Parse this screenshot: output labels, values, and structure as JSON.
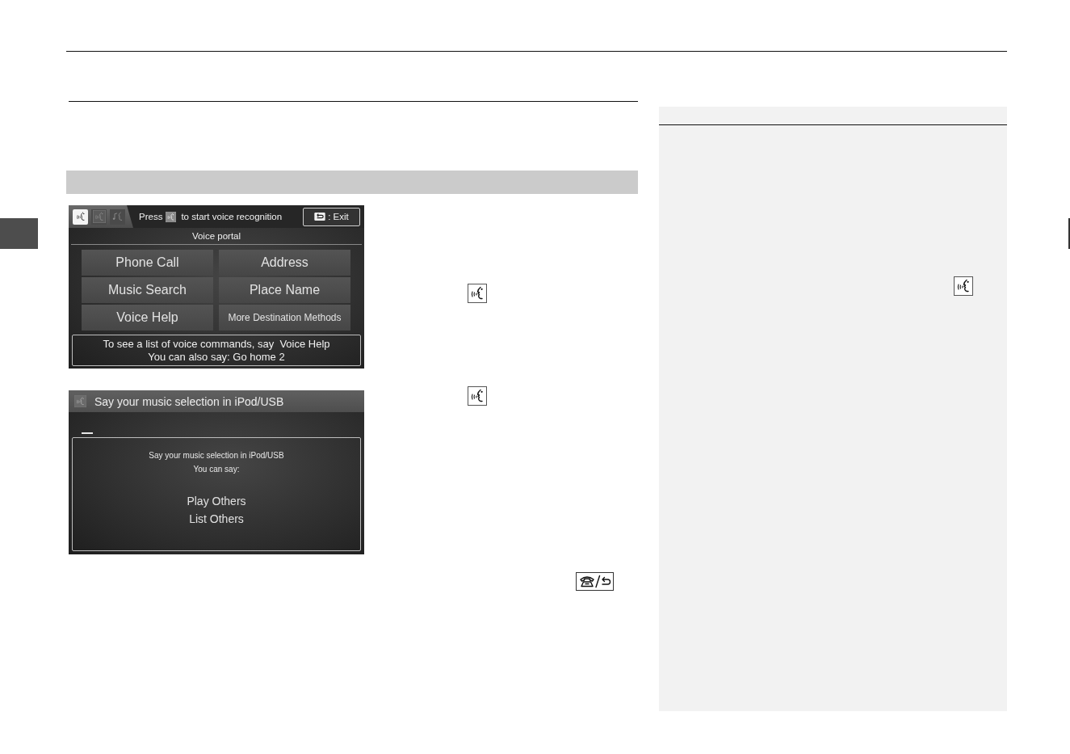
{
  "screens": [
    {
      "kind": "voice_portal",
      "tabs": [
        {
          "selected": true
        },
        {
          "selected": false
        },
        {
          "selected": false
        }
      ],
      "hint_before": "Press",
      "hint_after": "to start voice recognition",
      "exit_button": {
        "label": ": Exit"
      },
      "title": "Voice portal",
      "commands": [
        {
          "label": "Phone Call",
          "compact": false
        },
        {
          "label": "Address",
          "compact": false
        },
        {
          "label": "Music Search",
          "compact": false
        },
        {
          "label": "Place Name",
          "compact": false
        },
        {
          "label": "Voice Help",
          "compact": false
        },
        {
          "label": "More Destination Methods",
          "compact": true
        }
      ],
      "help_lines": [
        "To see a list of voice commands, say  Voice Help",
        "You can also say: Go home 2"
      ]
    },
    {
      "kind": "voice_prompt",
      "title": "Say your music selection in iPod/USB",
      "prompt_lines": [
        "Say your music selection in iPod/USB",
        "You can say:"
      ],
      "examples": [
        "Play Others",
        "List Others"
      ]
    }
  ]
}
